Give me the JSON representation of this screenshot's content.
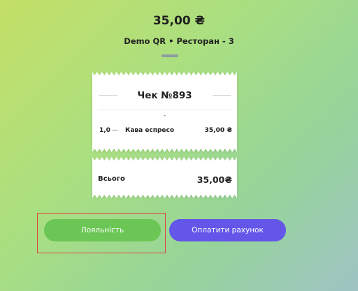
{
  "header": {
    "amount": "35,00 ₴",
    "venue": "Demo QR • Ресторан - 3"
  },
  "receipt": {
    "title": "Чек №893",
    "subtitle": "-",
    "items": [
      {
        "qty": "1,0",
        "dash": "—",
        "name": "Кава еспресо",
        "price": "35,00 ₴"
      }
    ],
    "total_label": "Всього",
    "total_value": "35,00₴"
  },
  "actions": {
    "loyalty_label": "Лояльність",
    "pay_label": "Оплатити рахунок"
  },
  "colors": {
    "loyalty_button": "#6bc655",
    "pay_button": "#6356e8",
    "highlight_border": "#e0463a"
  }
}
